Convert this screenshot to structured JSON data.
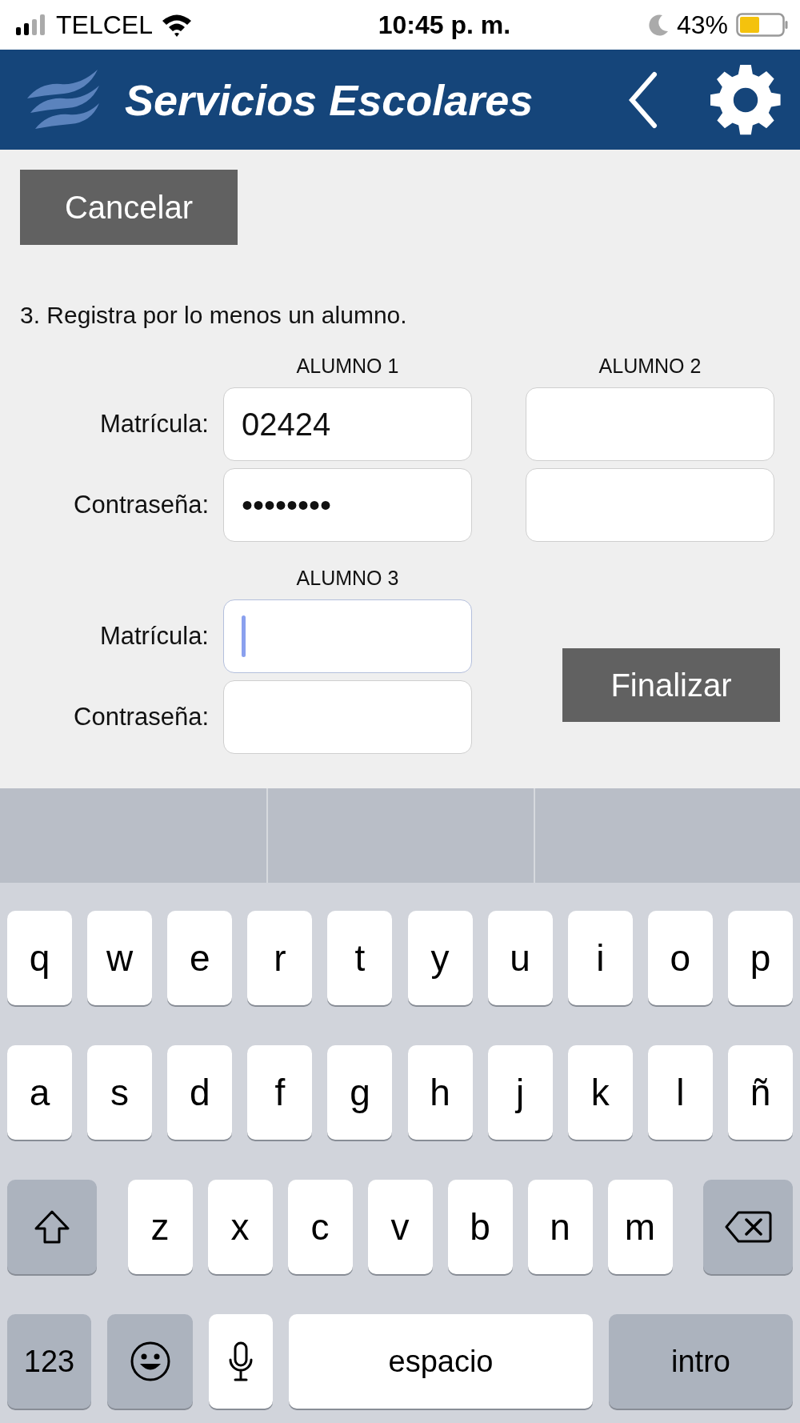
{
  "status_bar": {
    "carrier": "TELCEL",
    "time": "10:45 p. m.",
    "battery": "43%"
  },
  "header": {
    "title": "Servicios Escolares"
  },
  "cancel_button": "Cancelar",
  "instruction": "3. Registra por lo menos un alumno.",
  "students": [
    {
      "heading": "ALUMNO 1",
      "fields": [
        {
          "label": "Matrícula:",
          "value": "02424",
          "focused": false
        },
        {
          "label": "Contraseña:",
          "value": "••••••••",
          "focused": false
        }
      ]
    },
    {
      "heading": "ALUMNO 2",
      "fields": [
        {
          "focused": false
        },
        {
          "focused": false
        }
      ]
    },
    {
      "heading": "ALUMNO 3",
      "fields": [
        {
          "label": "Matrícula:",
          "focused": true
        },
        {
          "label": "Contraseña:",
          "focused": false
        }
      ]
    }
  ],
  "finish_button": "Finalizar",
  "keyboard": {
    "rows": [
      {
        "keys": [
          {
            "kind": "letter",
            "label": "q"
          },
          {
            "kind": "letter",
            "label": "w"
          },
          {
            "kind": "letter",
            "label": "e"
          },
          {
            "kind": "letter",
            "label": "r"
          },
          {
            "kind": "letter",
            "label": "t"
          },
          {
            "kind": "letter",
            "label": "y"
          },
          {
            "kind": "letter",
            "label": "u"
          },
          {
            "kind": "letter",
            "label": "i"
          },
          {
            "kind": "letter",
            "label": "o"
          },
          {
            "kind": "letter",
            "label": "p"
          }
        ]
      },
      {
        "keys": [
          {
            "kind": "letter",
            "label": "a"
          },
          {
            "kind": "letter",
            "label": "s"
          },
          {
            "kind": "letter",
            "label": "d"
          },
          {
            "kind": "letter",
            "label": "f"
          },
          {
            "kind": "letter",
            "label": "g"
          },
          {
            "kind": "letter",
            "label": "h"
          },
          {
            "kind": "letter",
            "label": "j"
          },
          {
            "kind": "letter",
            "label": "k"
          },
          {
            "kind": "letter",
            "label": "l"
          },
          {
            "kind": "letter",
            "label": "ñ"
          }
        ]
      },
      {
        "keys": [
          {
            "kind": "shift"
          },
          {
            "kind": "letter",
            "label": "z"
          },
          {
            "kind": "letter",
            "label": "x"
          },
          {
            "kind": "letter",
            "label": "c"
          },
          {
            "kind": "letter",
            "label": "v"
          },
          {
            "kind": "letter",
            "label": "b"
          },
          {
            "kind": "letter",
            "label": "n"
          },
          {
            "kind": "letter",
            "label": "m"
          },
          {
            "kind": "backspace"
          }
        ]
      },
      {
        "keys": [
          {
            "kind": "numbers",
            "label": "123"
          },
          {
            "kind": "emoji"
          },
          {
            "kind": "mic"
          },
          {
            "kind": "space",
            "label": "espacio"
          },
          {
            "kind": "return",
            "label": "intro"
          }
        ]
      }
    ]
  }
}
